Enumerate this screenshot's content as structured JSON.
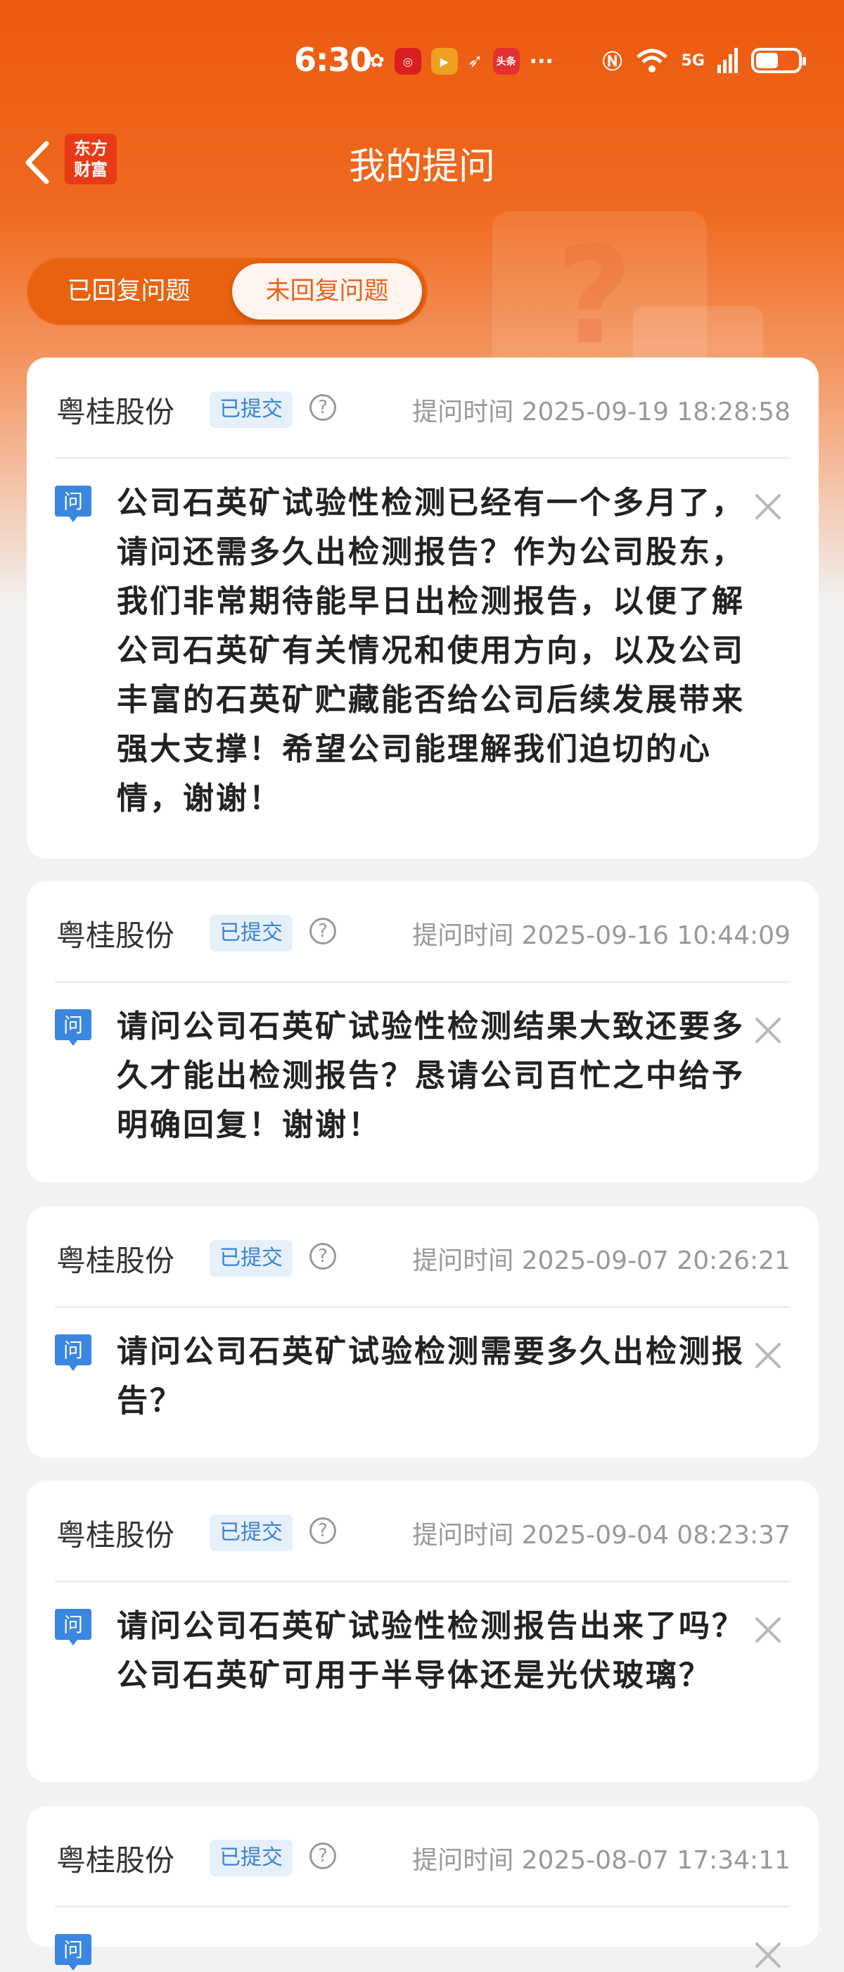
{
  "status_bar": {
    "time": "6:30",
    "network": "5G",
    "battery_percent": 60,
    "icons": [
      "app-icon-1",
      "app-icon-2",
      "video-app-icon",
      "send-icon",
      "toutiao-icon",
      "more-dots-icon",
      "nfc-icon",
      "wifi-icon",
      "signal-icon",
      "battery-icon"
    ]
  },
  "nav": {
    "title": "我的提问",
    "logo_line1": "东方",
    "logo_line2": "财富"
  },
  "tabs": [
    {
      "label": "已回复问题",
      "active": false
    },
    {
      "label": "未回复问题",
      "active": true
    }
  ],
  "questions": [
    {
      "company": "粤桂股份",
      "status": "已提交",
      "time": "提问时间 2025-09-19 18:28:58",
      "q_icon": "问",
      "text": "公司石英矿试验性检测已经有一个多月了，请问还需多久出检测报告？作为公司股东，我们非常期待能早日出检测报告，以便了解公司石英矿有关情况和使用方向，以及公司丰富的石英矿贮藏能否给公司后续发展带来强大支撑！希望公司能理解我们迫切的心情，谢谢！"
    },
    {
      "company": "粤桂股份",
      "status": "已提交",
      "time": "提问时间 2025-09-16 10:44:09",
      "q_icon": "问",
      "text": "请问公司石英矿试验性检测结果大致还要多久才能出检测报告？恳请公司百忙之中给予明确回复！谢谢！"
    },
    {
      "company": "粤桂股份",
      "status": "已提交",
      "time": "提问时间 2025-09-07 20:26:21",
      "q_icon": "问",
      "text": "请问公司石英矿试验检测需要多久出检测报告？"
    },
    {
      "company": "粤桂股份",
      "status": "已提交",
      "time": "提问时间 2025-09-04 08:23:37",
      "q_icon": "问",
      "text": "请问公司石英矿试验性检测报告出来了吗？公司石英矿可用于半导体还是光伏玻璃？"
    },
    {
      "company": "粤桂股份",
      "status": "已提交",
      "time": "提问时间 2025-08-07 17:34:11",
      "q_icon": "问",
      "text": ""
    }
  ],
  "colors": {
    "brand": "#ec5a10",
    "badge_text": "#3b82d6",
    "badge_bg": "#e6f0fb",
    "q_icon": "#3a86e0"
  }
}
